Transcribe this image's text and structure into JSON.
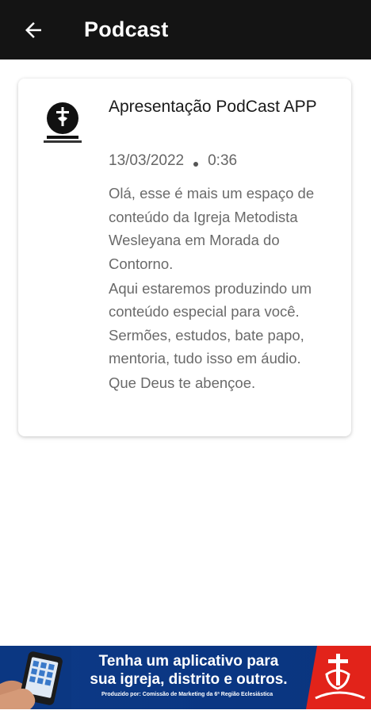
{
  "appbar": {
    "title": "Podcast",
    "back_icon": "arrow-left-icon"
  },
  "episode": {
    "title": "Apresentação PodCast APP",
    "date": "13/03/2022",
    "duration": "0:36",
    "description": [
      "Olá, esse é mais um espaço de conteúdo da Igreja Metodista Wesleyana em Morada do Contorno.",
      "Aqui estaremos produzindo um conteúdo especial para você. Sermões, estudos, bate papo, mentoria, tudo isso em áudio.",
      "Que Deus te abençoe."
    ]
  },
  "banner": {
    "line1": "Tenha um aplicativo para",
    "line2": "sua igreja, distrito e outros.",
    "credit": "Produzido por: Comissão de Marketing da 6ª Região Eclesiástica",
    "colors": {
      "background": "#0b3782",
      "accent": "#e2231a"
    }
  }
}
